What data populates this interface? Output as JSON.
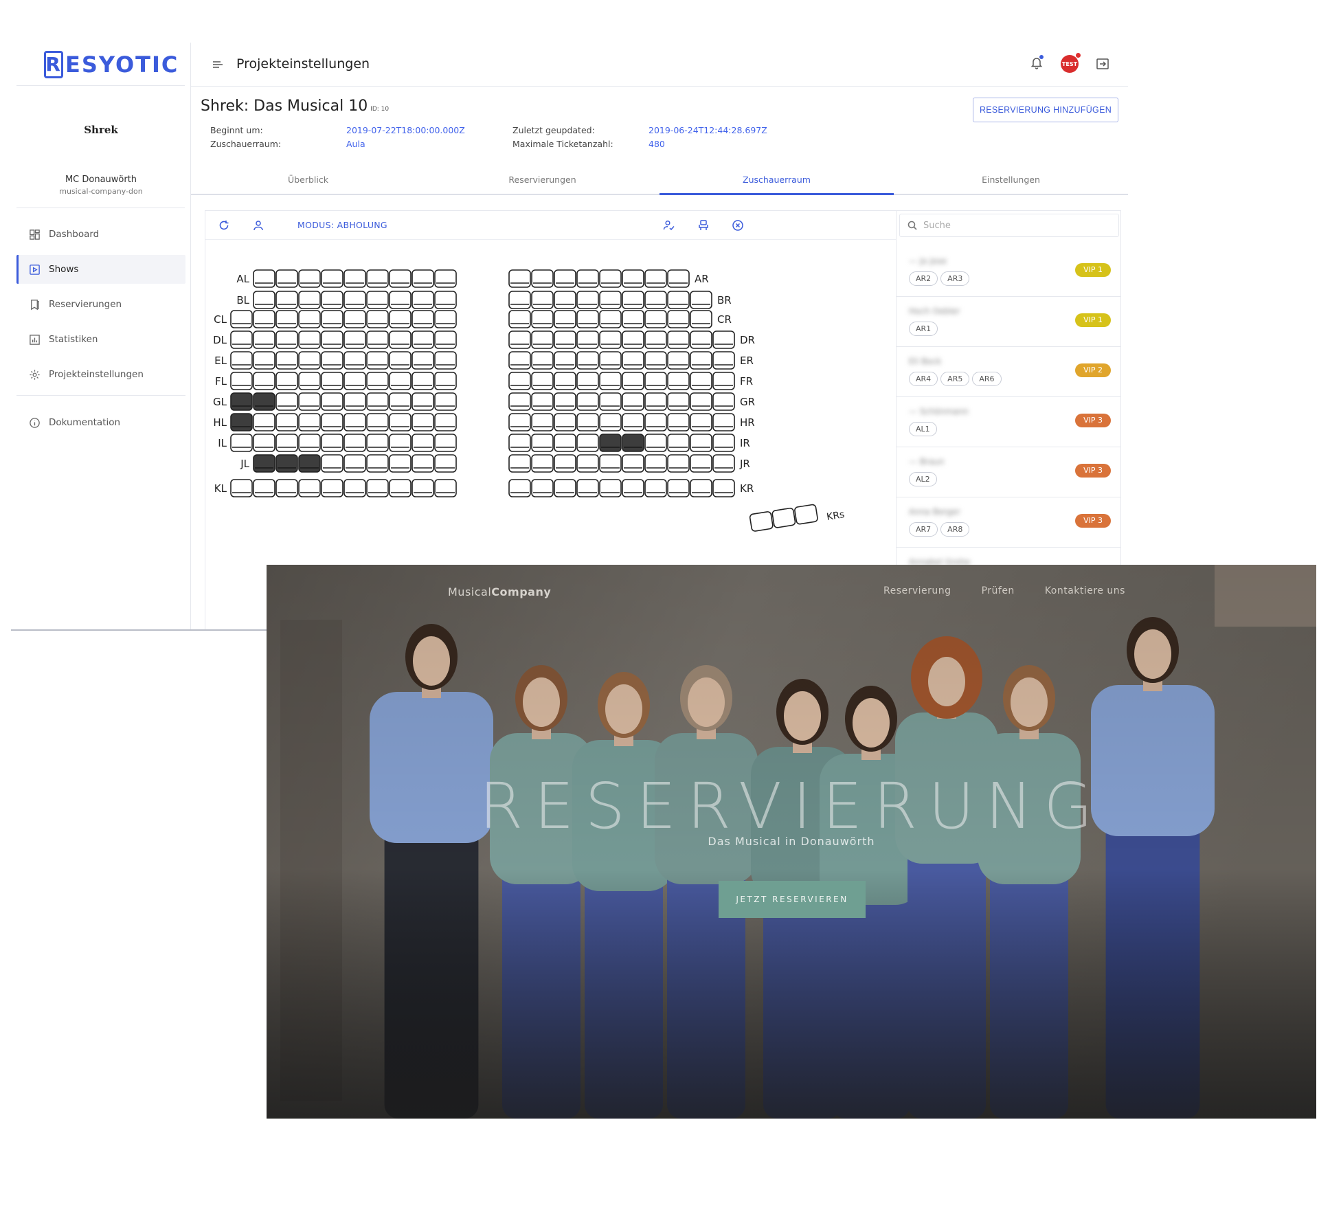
{
  "app": {
    "logo_initial": "R",
    "logo_rest": "ESYOTIC",
    "company_logo_text": "Shrek",
    "company_name": "MC Donauwörth",
    "company_slug": "musical-company-don",
    "nav": [
      {
        "label": "Dashboard",
        "icon": "dashboard-icon"
      },
      {
        "label": "Shows",
        "icon": "play-square-icon",
        "active": true
      },
      {
        "label": "Reservierungen",
        "icon": "bookmark-icon"
      },
      {
        "label": "Statistiken",
        "icon": "bar-chart-icon"
      },
      {
        "label": "Projekteinstellungen",
        "icon": "gear-icon"
      },
      {
        "label": "Dokumentation",
        "icon": "info-icon"
      }
    ],
    "page_title": "Projekteinstellungen",
    "avatar_text": "TEST",
    "show": {
      "title": "Shrek: Das Musical 10",
      "id_label": "ID: 10",
      "begin_label": "Beginnt um:",
      "begin_value": "2019-07-22T18:00:00.000Z",
      "room_label": "Zuschauerraum:",
      "room_value": "Aula",
      "updated_label": "Zuletzt geupdated:",
      "updated_value": "2019-06-24T12:44:28.697Z",
      "max_label": "Maximale Ticketanzahl:",
      "max_value": "480",
      "add_button": "RESERVIERUNG HINZUFÜGEN"
    },
    "tabs": [
      "Überblick",
      "Reservierungen",
      "Zuschauerraum",
      "Einstellungen"
    ],
    "active_tab": 2,
    "seat_toolbar": {
      "mode": "MODUS: ABHOLUNG"
    },
    "search_placeholder": "Suche",
    "accent": "#3b5bdb",
    "reservations": [
      {
        "name": "— Jo Jose",
        "seats": [
          "AR2",
          "AR3"
        ],
        "badge": "VIP 1",
        "color": "#d6c21a"
      },
      {
        "name": "Hoch Oebler",
        "seats": [
          "AR1"
        ],
        "badge": "VIP 1",
        "color": "#d6c21a"
      },
      {
        "name": "Eli Bock",
        "seats": [
          "AR4",
          "AR5",
          "AR6"
        ],
        "badge": "VIP 2",
        "color": "#e0a52c"
      },
      {
        "name": "— Schönmann",
        "seats": [
          "AL1"
        ],
        "badge": "VIP 3",
        "color": "#d9733a"
      },
      {
        "name": "— Braun",
        "seats": [
          "AL2"
        ],
        "badge": "VIP 3",
        "color": "#d9733a"
      },
      {
        "name": "Anna Berger",
        "seats": [
          "AR7",
          "AR8"
        ],
        "badge": "VIP 3",
        "color": "#d9733a"
      },
      {
        "name": "Annabel Grohe",
        "seats": [],
        "badge": "",
        "color": "#d9733a"
      }
    ]
  },
  "seatmap": {
    "left_rows": [
      {
        "label": "AL",
        "count": 9,
        "offset": 1,
        "taken": []
      },
      {
        "label": "BL",
        "count": 9,
        "offset": 1,
        "taken": []
      },
      {
        "label": "CL",
        "count": 10,
        "offset": 0,
        "taken": []
      },
      {
        "label": "DL",
        "count": 10,
        "offset": 0,
        "taken": []
      },
      {
        "label": "EL",
        "count": 10,
        "offset": 0,
        "taken": []
      },
      {
        "label": "FL",
        "count": 10,
        "offset": 0,
        "taken": []
      },
      {
        "label": "GL",
        "count": 10,
        "offset": 0,
        "taken": [
          0,
          1
        ]
      },
      {
        "label": "HL",
        "count": 10,
        "offset": 0,
        "taken": [
          0
        ]
      },
      {
        "label": "IL",
        "count": 10,
        "offset": 0,
        "taken": []
      },
      {
        "label": "JL",
        "count": 9,
        "offset": 1,
        "taken": [
          0,
          1,
          2
        ]
      },
      {
        "label": "KL",
        "count": 10,
        "offset": 0,
        "taken": []
      }
    ],
    "right_rows": [
      {
        "label": "AR",
        "count": 8,
        "taken": []
      },
      {
        "label": "BR",
        "count": 9,
        "taken": []
      },
      {
        "label": "CR",
        "count": 9,
        "taken": []
      },
      {
        "label": "DR",
        "count": 10,
        "taken": []
      },
      {
        "label": "ER",
        "count": 10,
        "taken": []
      },
      {
        "label": "FR",
        "count": 10,
        "taken": []
      },
      {
        "label": "GR",
        "count": 10,
        "taken": []
      },
      {
        "label": "HR",
        "count": 10,
        "taken": []
      },
      {
        "label": "IR",
        "count": 10,
        "taken": [
          4,
          5
        ]
      },
      {
        "label": "JR",
        "count": 10,
        "taken": []
      },
      {
        "label": "KR",
        "count": 10,
        "taken": []
      }
    ],
    "extra_label": "KRs",
    "extra_count": 3,
    "taken_color": "#3d3d3d"
  },
  "site": {
    "brand_light": "Musical",
    "brand_bold": "Company",
    "nav": [
      "Reservierung",
      "Prüfen",
      "Kontaktiere uns"
    ],
    "hero_title": "RESERVIERUNG",
    "hero_sub": "Das Musical in Donauwörth",
    "cta": "JETZT RESERVIEREN",
    "cta_color": "#6f9f92",
    "people_count": 9
  }
}
